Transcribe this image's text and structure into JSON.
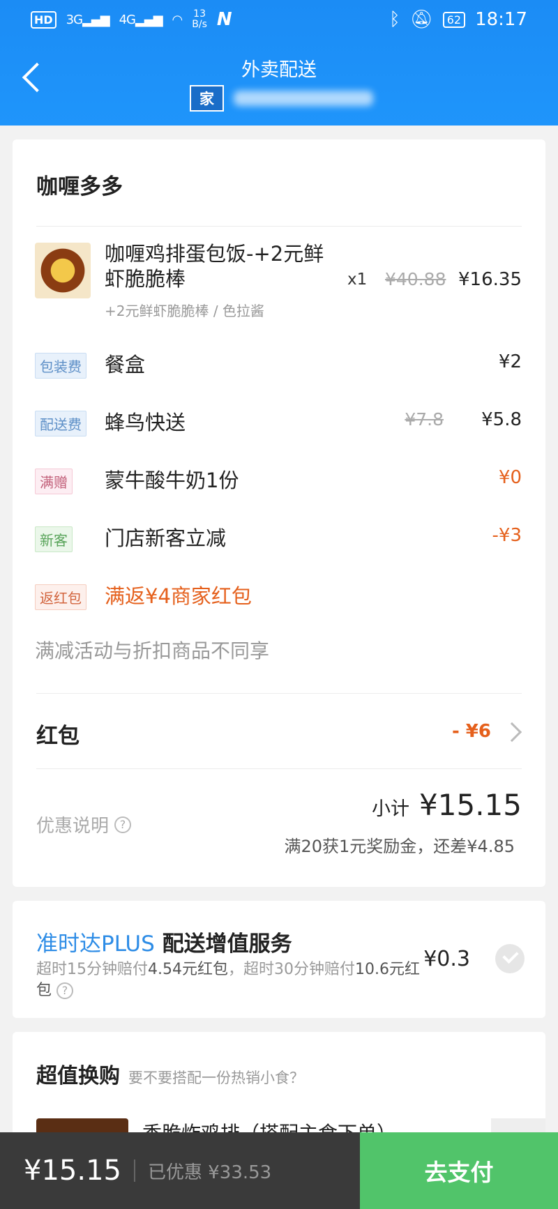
{
  "status_bar": {
    "hd": "HD",
    "signal_3g": "3G",
    "signal_4g": "4G",
    "speed_value": "13",
    "speed_unit": "B/s",
    "app_n": "N",
    "battery": "62",
    "time": "18:17"
  },
  "header": {
    "title": "外卖配送",
    "address_tag": "家"
  },
  "shop": {
    "name": "咖喱多多"
  },
  "item": {
    "name": "咖喱鸡排蛋包饭-+2元鲜虾脆脆棒",
    "spec": "+2元鲜虾脆脆棒 / 色拉酱",
    "qty": "x1",
    "original_price": "¥40.88",
    "price": "¥16.35"
  },
  "fees": [
    {
      "tag": "包装费",
      "label": "餐盒",
      "original": "",
      "price": "¥2"
    },
    {
      "tag": "配送费",
      "label": "蜂鸟快送",
      "original": "¥7.8",
      "price": "¥5.8"
    },
    {
      "tag": "满赠",
      "label": "蒙牛酸牛奶1份",
      "original": "",
      "price": "¥0"
    },
    {
      "tag": "新客",
      "label": "门店新客立减",
      "original": "",
      "price": "-¥3"
    },
    {
      "tag": "返红包",
      "label": "满返¥4商家红包",
      "original": "",
      "price": ""
    }
  ],
  "notice": "满减活动与折扣商品不同享",
  "hongbao": {
    "label": "红包",
    "value": "- ¥6"
  },
  "summary": {
    "promo_label": "优惠说明",
    "subtotal_label": "小计",
    "subtotal_value": "¥15.15",
    "bonus_text": "满20获1元奖励金，还差¥4.85"
  },
  "plus_service": {
    "brand": "准时达PLUS",
    "title": "配送增值服务",
    "desc_1": "超时15分钟赔付",
    "amount_1": "4.54元红包",
    "desc_2": "，超时30分钟赔付",
    "amount_2": "10.6元红包",
    "price": "¥0.3"
  },
  "deals": {
    "title": "超值换购",
    "subtitle": "要不要搭配一份热销小食？",
    "item_name": "香脆炸鸡排（搭配主食下单）"
  },
  "bottom_bar": {
    "total": "¥15.15",
    "saved": "已优惠 ¥33.53",
    "pay_button": "去支付"
  },
  "icons": {
    "back": "back-arrow-icon",
    "help": "question-circle-icon",
    "chevron": "chevron-right-icon",
    "check": "check-circle-icon"
  }
}
